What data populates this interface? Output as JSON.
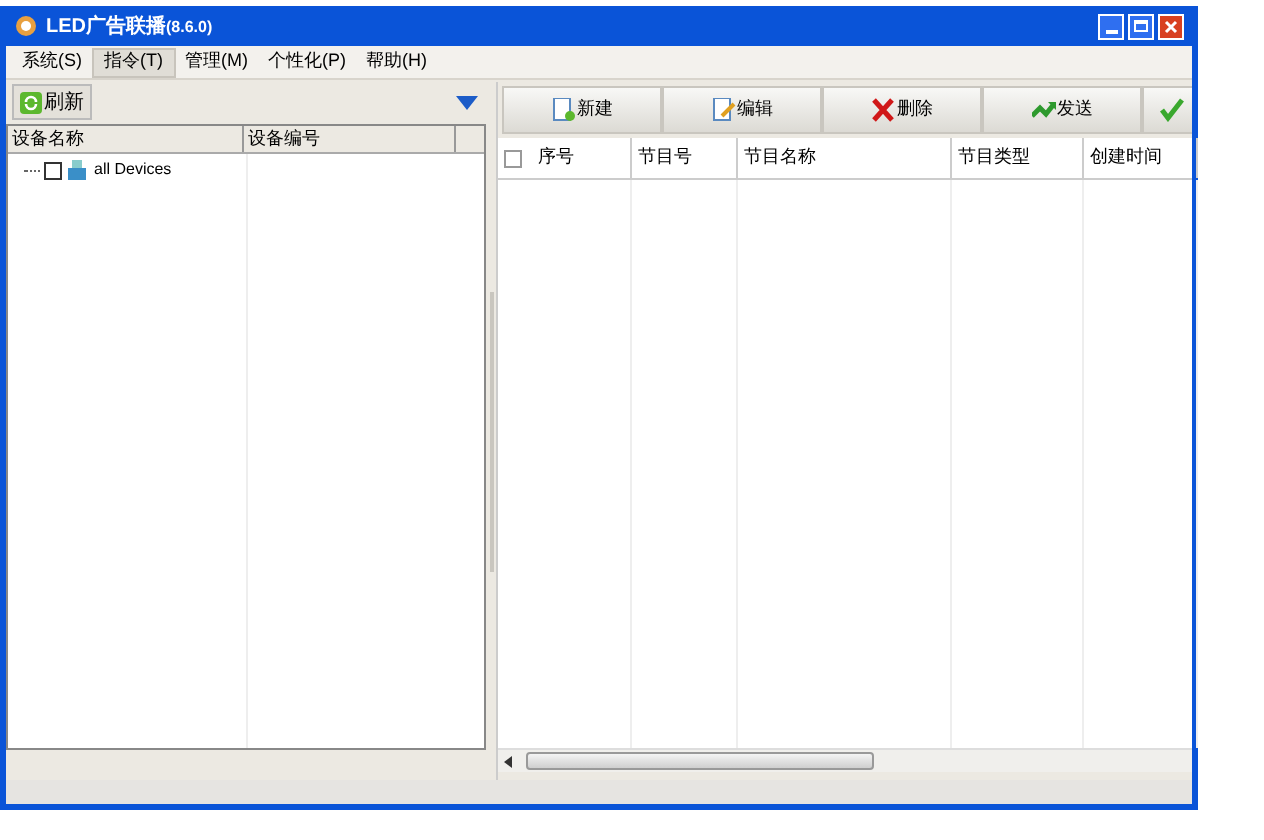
{
  "window": {
    "title": "LED广告联播",
    "version": "(8.6.0)"
  },
  "menu": [
    {
      "label": "系统(S)",
      "selected": false
    },
    {
      "label": "指令(T)",
      "selected": true
    },
    {
      "label": "管理(M)",
      "selected": false
    },
    {
      "label": "个性化(P)",
      "selected": false
    },
    {
      "label": "帮助(H)",
      "selected": false
    }
  ],
  "left_panel": {
    "refresh_button": "刷新",
    "columns": [
      "设备名称",
      "设备编号"
    ],
    "tree": [
      {
        "label": "all Devices",
        "checked": false
      }
    ]
  },
  "toolbar": [
    {
      "label": "新建",
      "kind": "new"
    },
    {
      "label": "编辑",
      "kind": "edit"
    },
    {
      "label": "删除",
      "kind": "delete"
    },
    {
      "label": "发送",
      "kind": "send"
    },
    {
      "kind": "check"
    }
  ],
  "table": {
    "select_all": false,
    "columns": [
      "序号",
      "节目号",
      "节目名称",
      "节目类型",
      "创建时间"
    ]
  }
}
